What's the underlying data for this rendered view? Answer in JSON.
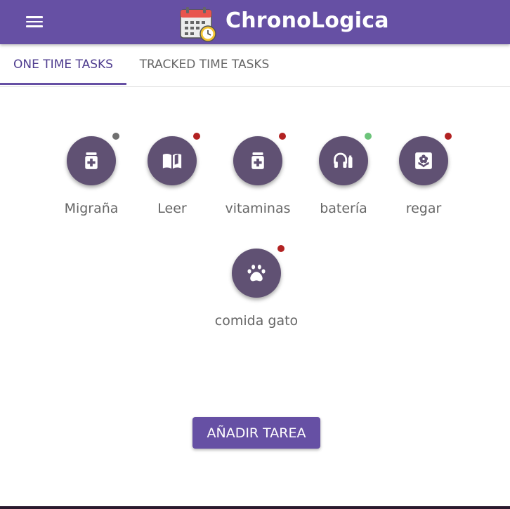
{
  "app": {
    "title": "ChronoLogica",
    "brand_color": "#6650a4"
  },
  "tabs": [
    {
      "label": "ONE TIME TASKS",
      "active": true
    },
    {
      "label": "TRACKED TIME TASKS",
      "active": false
    }
  ],
  "tasks": [
    {
      "label": "Migraña",
      "icon": "medicine-bottle-icon",
      "status_color": "#707070"
    },
    {
      "label": "Leer",
      "icon": "open-book-icon",
      "status_color": "#b22222"
    },
    {
      "label": "vitaminas",
      "icon": "medicine-bottle-icon",
      "status_color": "#b22222"
    },
    {
      "label": "batería",
      "icon": "headphones-battery-icon",
      "status_color": "#6cc47a"
    },
    {
      "label": "regar",
      "icon": "flower-pot-icon",
      "status_color": "#b22222"
    },
    {
      "label": "comida gato",
      "icon": "paw-icon",
      "status_color": "#b22222"
    }
  ],
  "add_button": {
    "label": "AÑADIR TAREA"
  }
}
